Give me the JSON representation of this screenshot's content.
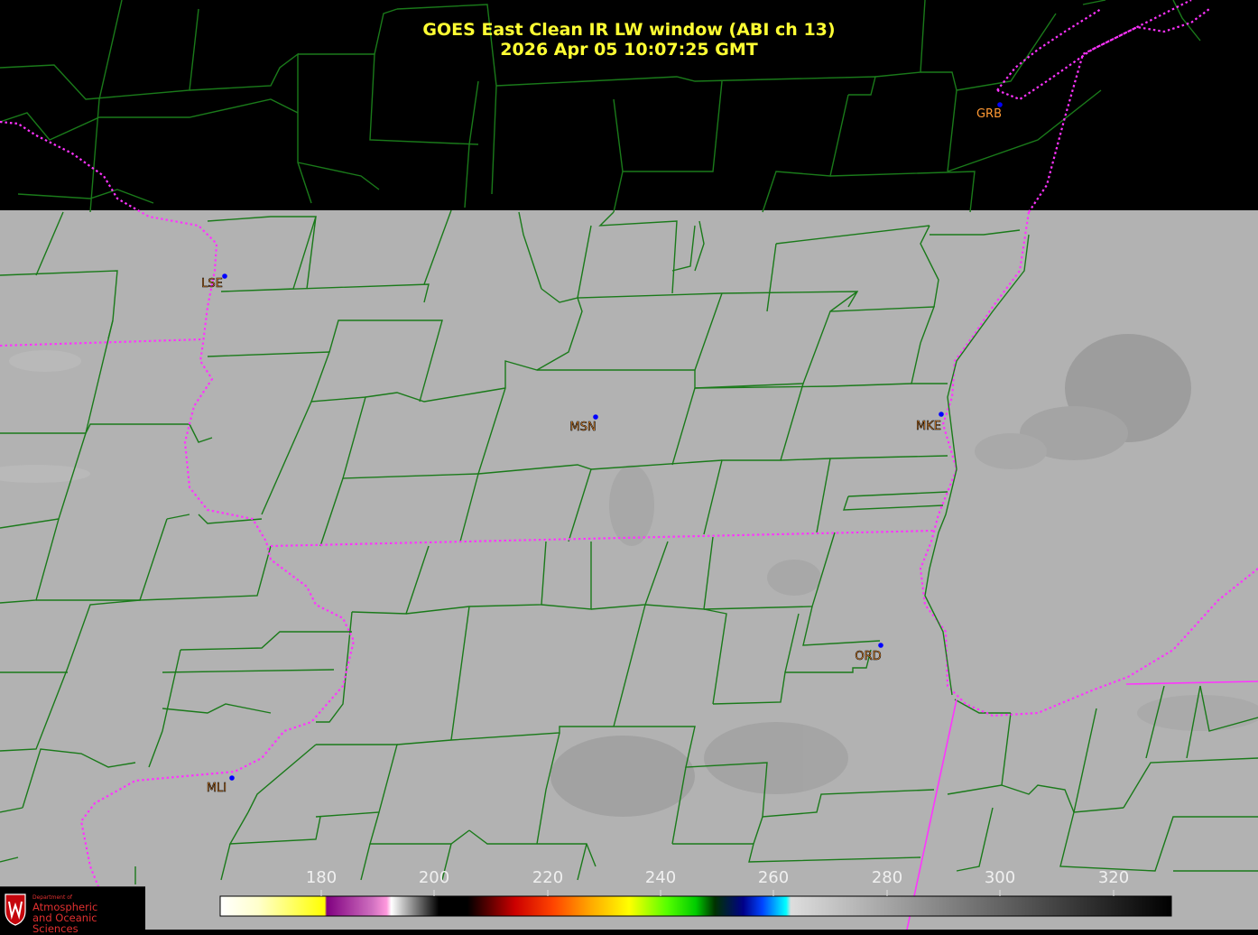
{
  "header": {
    "title": "GOES East Clean IR LW window (ABI ch 13)",
    "timestamp": "2026 Apr 05  10:07:25 GMT"
  },
  "stations": [
    {
      "code": "GRB",
      "color": "#ff9933",
      "style": "plain"
    },
    {
      "code": "LSE",
      "color": "#ff9933",
      "style": "outlined"
    },
    {
      "code": "MSN",
      "color": "#ff9933",
      "style": "outlined"
    },
    {
      "code": "MKE",
      "color": "#ff9933",
      "style": "outlined"
    },
    {
      "code": "ORD",
      "color": "#ff9933",
      "style": "outlined"
    },
    {
      "code": "MLI",
      "color": "#ff9933",
      "style": "outlined"
    }
  ],
  "colorbar": {
    "tick_labels": [
      "180",
      "200",
      "220",
      "240",
      "260",
      "280",
      "300",
      "320"
    ],
    "colors": [
      "#ffffff",
      "#ffff00",
      "#800080",
      "#ff88cc",
      "#000000",
      "#cc0000",
      "#ff8800",
      "#ffff00",
      "#00ff00",
      "#000088",
      "#00ffff",
      "#cccccc",
      "#000000"
    ]
  },
  "logo": {
    "line1": "Department of",
    "line2": "Atmospheric",
    "line3": "and Oceanic Sciences"
  },
  "colors": {
    "county_border": "#1a7a1a",
    "state_border": "#ff33ff",
    "title_text": "#ffff33",
    "cloud_gray": "#b4b4b4",
    "station_dot": "#0000ff"
  }
}
